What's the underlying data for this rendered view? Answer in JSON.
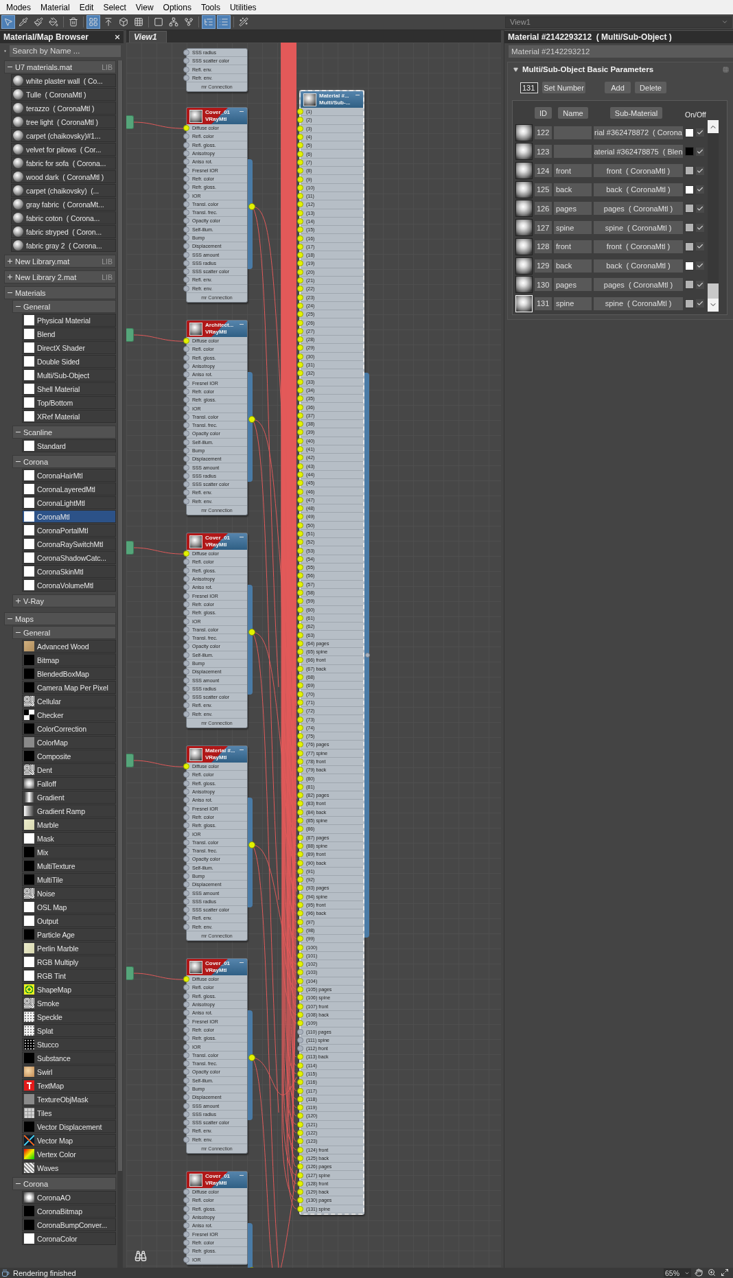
{
  "menu": [
    "Modes",
    "Material",
    "Edit",
    "Select",
    "View",
    "Options",
    "Tools",
    "Utilities"
  ],
  "toolbar_buttons": [
    {
      "active": true
    },
    {
      "active": false
    },
    {
      "active": false
    },
    {
      "active": false
    },
    {
      "active": false
    },
    {
      "active": true
    },
    {
      "active": false
    },
    {
      "active": false
    },
    {
      "active": false
    },
    {
      "active": false
    },
    {
      "active": false
    },
    {
      "active": false
    },
    {
      "active": true
    },
    {
      "active": true
    },
    {
      "active": false
    }
  ],
  "view_selector": "View1",
  "browser": {
    "title": "Material/Map Browser",
    "search": {
      "placeholder": "Search by Name ..."
    },
    "groups": [
      {
        "label": "U7 materials.mat",
        "badge": "LIB",
        "expanded": true,
        "items": [
          {
            "label": "white plaster wall  ( Co...",
            "kind": "sphere",
            "selected": false
          },
          {
            "label": "Tulle  ( CoronaMtl )",
            "kind": "sphere",
            "selected": false
          },
          {
            "label": "terazzo  ( CoronaMtl )",
            "kind": "sphere",
            "selected": false
          },
          {
            "label": "tree light  ( CoronaMtl )",
            "kind": "sphere",
            "selected": false
          },
          {
            "label": "carpet (chaikovsky)#1...",
            "kind": "sphere",
            "selected": false
          },
          {
            "label": "velvet for pilows  ( Cor...",
            "kind": "sphere",
            "selected": false
          },
          {
            "label": "fabric for sofa  ( Corona...",
            "kind": "sphere",
            "selected": false
          },
          {
            "label": "wood dark  ( CoronaMtl )",
            "kind": "sphere",
            "selected": false
          },
          {
            "label": "carpet (chaikovsky)  (...",
            "kind": "sphere",
            "selected": false
          },
          {
            "label": "gray fabric  ( CoronaMt...",
            "kind": "sphere",
            "selected": false
          },
          {
            "label": "fabric coton  ( Corona...",
            "kind": "sphere",
            "selected": false
          },
          {
            "label": "fabric stryped  ( Coron...",
            "kind": "sphere",
            "selected": false
          },
          {
            "label": "fabric gray 2  ( Corona...",
            "kind": "sphere",
            "selected": false
          }
        ]
      },
      {
        "label": "New Library.mat",
        "badge": "LIB",
        "expanded": false
      },
      {
        "label": "New Library 2.mat",
        "badge": "LIB",
        "expanded": false
      },
      {
        "label": "Materials",
        "expanded": true,
        "groups": [
          {
            "label": "General",
            "expanded": true,
            "items": [
              {
                "label": "Physical Material",
                "kind": "white",
                "selected": false
              },
              {
                "label": "Blend",
                "kind": "white",
                "selected": false
              },
              {
                "label": "DirectX Shader",
                "kind": "white",
                "selected": false
              },
              {
                "label": "Double Sided",
                "kind": "white",
                "selected": false
              },
              {
                "label": "Multi/Sub-Object",
                "kind": "white",
                "selected": false
              },
              {
                "label": "Shell Material",
                "kind": "white",
                "selected": false
              },
              {
                "label": "Top/Bottom",
                "kind": "white",
                "selected": false
              },
              {
                "label": "XRef Material",
                "kind": "white",
                "selected": false
              }
            ]
          },
          {
            "label": "Scanline",
            "expanded": true,
            "items": [
              {
                "label": "Standard",
                "kind": "white",
                "selected": false
              }
            ]
          },
          {
            "label": "Corona",
            "expanded": true,
            "items": [
              {
                "label": "CoronaHairMtl",
                "kind": "white",
                "selected": false
              },
              {
                "label": "CoronaLayeredMtl",
                "kind": "white",
                "selected": false
              },
              {
                "label": "CoronaLightMtl",
                "kind": "white",
                "selected": false
              },
              {
                "label": "CoronaMtl",
                "kind": "white",
                "selected": true
              },
              {
                "label": "CoronaPortalMtl",
                "kind": "white",
                "selected": false
              },
              {
                "label": "CoronaRaySwitchMtl",
                "kind": "white",
                "selected": false
              },
              {
                "label": "CoronaShadowCatc...",
                "kind": "white",
                "selected": false
              },
              {
                "label": "CoronaSkinMtl",
                "kind": "white",
                "selected": false
              },
              {
                "label": "CoronaVolumeMtl",
                "kind": "white",
                "selected": false
              }
            ]
          },
          {
            "label": "V-Ray",
            "expanded": false
          }
        ]
      },
      {
        "label": "Maps",
        "expanded": true,
        "groups": [
          {
            "label": "General",
            "expanded": true,
            "items": [
              {
                "label": "Advanced Wood",
                "kind": "wood",
                "selected": false
              },
              {
                "label": "Bitmap",
                "kind": "black",
                "selected": false
              },
              {
                "label": "BlendedBoxMap",
                "kind": "black",
                "selected": false
              },
              {
                "label": "Camera Map Per Pixel",
                "kind": "black",
                "selected": false
              },
              {
                "label": "Cellular",
                "kind": "noise",
                "selected": false
              },
              {
                "label": "Checker",
                "kind": "checker",
                "selected": false
              },
              {
                "label": "ColorCorrection",
                "kind": "black",
                "selected": false
              },
              {
                "label": "ColorMap",
                "kind": "gray",
                "selected": false
              },
              {
                "label": "Composite",
                "kind": "black",
                "selected": false
              },
              {
                "label": "Dent",
                "kind": "noise",
                "selected": false
              },
              {
                "label": "Falloff",
                "kind": "falloff",
                "selected": false
              },
              {
                "label": "Gradient",
                "kind": "gradient",
                "selected": false
              },
              {
                "label": "Gradient Ramp",
                "kind": "ramp",
                "selected": false
              },
              {
                "label": "Marble",
                "kind": "marble",
                "selected": false
              },
              {
                "label": "Mask",
                "kind": "white",
                "selected": false
              },
              {
                "label": "Mix",
                "kind": "black",
                "selected": false
              },
              {
                "label": "MultiTexture",
                "kind": "black",
                "selected": false
              },
              {
                "label": "MultiTile",
                "kind": "black",
                "selected": false
              },
              {
                "label": "Noise",
                "kind": "noise",
                "selected": false
              },
              {
                "label": "OSL Map",
                "kind": "white",
                "selected": false
              },
              {
                "label": "Output",
                "kind": "white",
                "selected": false
              },
              {
                "label": "Particle Age",
                "kind": "black",
                "selected": false
              },
              {
                "label": "Perlin Marble",
                "kind": "marble",
                "selected": false
              },
              {
                "label": "RGB Multiply",
                "kind": "white",
                "selected": false
              },
              {
                "label": "RGB Tint",
                "kind": "white",
                "selected": false
              },
              {
                "label": "ShapeMap",
                "kind": "spiral",
                "selected": false
              },
              {
                "label": "Smoke",
                "kind": "noise",
                "selected": false
              },
              {
                "label": "Speckle",
                "kind": "speckle",
                "selected": false
              },
              {
                "label": "Splat",
                "kind": "speckle",
                "selected": false
              },
              {
                "label": "Stucco",
                "kind": "stucco",
                "selected": false
              },
              {
                "label": "Substance",
                "kind": "black",
                "selected": false
              },
              {
                "label": "Swirl",
                "kind": "swirl",
                "selected": false
              },
              {
                "label": "TextMap",
                "kind": "text",
                "selected": false
              },
              {
                "label": "TextureObjMask",
                "kind": "gray",
                "selected": false
              },
              {
                "label": "Tiles",
                "kind": "tiles",
                "selected": false
              },
              {
                "label": "Vector Displacement",
                "kind": "black",
                "selected": false
              },
              {
                "label": "Vector Map",
                "kind": "vector",
                "selected": false
              },
              {
                "label": "Vertex Color",
                "kind": "rainbow",
                "selected": false
              },
              {
                "label": "Waves",
                "kind": "waves",
                "selected": false
              }
            ]
          },
          {
            "label": "Corona",
            "expanded": true,
            "items": [
              {
                "label": "CoronaAO",
                "kind": "ao",
                "selected": false
              },
              {
                "label": "CoronaBitmap",
                "kind": "black",
                "selected": false
              },
              {
                "label": "CoronaBumpConver...",
                "kind": "black",
                "selected": false
              },
              {
                "label": "CoronaColor",
                "kind": "white",
                "selected": false
              }
            ]
          }
        ]
      }
    ]
  },
  "view": {
    "tab": "View1",
    "nodes": [
      {
        "kind": "vraymtl",
        "selected": false,
        "footer": "mr Connection",
        "slots": [
          {
            "label": "SSS radius",
            "connected": false
          },
          {
            "label": "SSS scatter color",
            "connected": false
          },
          {
            "label": "Refl. env.",
            "connected": false
          },
          {
            "label": "Refr. env.",
            "connected": false
          }
        ]
      },
      {
        "kind": "vraymtl",
        "title": [
          "Cover_01",
          "VRayMtl"
        ],
        "selected": false,
        "footer": "mr Connection",
        "slots": [
          {
            "label": "Diffuse color",
            "connected": true
          },
          {
            "label": "Refl. color",
            "connected": false
          },
          {
            "label": "Refl. gloss.",
            "connected": false
          },
          {
            "label": "Anisotropy",
            "connected": false
          },
          {
            "label": "Aniso rot.",
            "connected": false
          },
          {
            "label": "Fresnel IOR",
            "connected": false
          },
          {
            "label": "Refr. color",
            "connected": false
          },
          {
            "label": "Refr. gloss.",
            "connected": false
          },
          {
            "label": "IOR",
            "connected": false
          },
          {
            "label": "Transl. color",
            "connected": false
          },
          {
            "label": "Transl. frec.",
            "connected": false
          },
          {
            "label": "Opacity color",
            "connected": false
          },
          {
            "label": "Self-illum.",
            "connected": false
          },
          {
            "label": "Bump",
            "connected": false
          },
          {
            "label": "Displacement",
            "connected": false
          },
          {
            "label": "SSS amount",
            "connected": false
          },
          {
            "label": "SSS radius",
            "connected": false
          },
          {
            "label": "SSS scatter color",
            "connected": false
          },
          {
            "label": "Refl. env.",
            "connected": false
          },
          {
            "label": "Refr. env.",
            "connected": false
          }
        ]
      },
      {
        "kind": "vraymtl",
        "title": [
          "Architect...",
          "VRayMtl"
        ],
        "selected": false,
        "footer": "mr Connection",
        "slots": [
          {
            "label": "Diffuse color",
            "connected": true
          },
          {
            "label": "Refl. color",
            "connected": false
          },
          {
            "label": "Refl. gloss.",
            "connected": false
          },
          {
            "label": "Anisotropy",
            "connected": false
          },
          {
            "label": "Aniso rot.",
            "connected": false
          },
          {
            "label": "Fresnel IOR",
            "connected": false
          },
          {
            "label": "Refr. color",
            "connected": false
          },
          {
            "label": "Refr. gloss.",
            "connected": false
          },
          {
            "label": "IOR",
            "connected": false
          },
          {
            "label": "Transl. color",
            "connected": false
          },
          {
            "label": "Transl. frec.",
            "connected": false
          },
          {
            "label": "Opacity color",
            "connected": false
          },
          {
            "label": "Self-illum.",
            "connected": false
          },
          {
            "label": "Bump",
            "connected": false
          },
          {
            "label": "Displacement",
            "connected": false
          },
          {
            "label": "SSS amount",
            "connected": false
          },
          {
            "label": "SSS radius",
            "connected": false
          },
          {
            "label": "SSS scatter color",
            "connected": false
          },
          {
            "label": "Refl. env.",
            "connected": false
          },
          {
            "label": "Refr. env.",
            "connected": false
          }
        ]
      },
      {
        "kind": "vraymtl",
        "title": [
          "Cover_01",
          "VRayMtl"
        ],
        "selected": false,
        "footer": "mr Connection",
        "slots": [
          {
            "label": "Diffuse color",
            "connected": true
          },
          {
            "label": "Refl. color",
            "connected": false
          },
          {
            "label": "Refl. gloss.",
            "connected": false
          },
          {
            "label": "Anisotropy",
            "connected": false
          },
          {
            "label": "Aniso rot.",
            "connected": false
          },
          {
            "label": "Fresnel IOR",
            "connected": false
          },
          {
            "label": "Refr. color",
            "connected": false
          },
          {
            "label": "Refr. gloss.",
            "connected": false
          },
          {
            "label": "IOR",
            "connected": false
          },
          {
            "label": "Transl. color",
            "connected": false
          },
          {
            "label": "Transl. frec.",
            "connected": false
          },
          {
            "label": "Opacity color",
            "connected": false
          },
          {
            "label": "Self-illum.",
            "connected": false
          },
          {
            "label": "Bump",
            "connected": false
          },
          {
            "label": "Displacement",
            "connected": false
          },
          {
            "label": "SSS amount",
            "connected": false
          },
          {
            "label": "SSS radius",
            "connected": false
          },
          {
            "label": "SSS scatter color",
            "connected": false
          },
          {
            "label": "Refl. env.",
            "connected": false
          },
          {
            "label": "Refr. env.",
            "connected": false
          }
        ]
      },
      {
        "kind": "vraymtl",
        "title": [
          "Material #...",
          "VRayMtl"
        ],
        "selected": false,
        "footer": "mr Connection",
        "slots": [
          {
            "label": "Diffuse color",
            "connected": true
          },
          {
            "label": "Refl. color",
            "connected": false
          },
          {
            "label": "Refl. gloss.",
            "connected": false
          },
          {
            "label": "Anisotropy",
            "connected": false
          },
          {
            "label": "Aniso rot.",
            "connected": false
          },
          {
            "label": "Fresnel IOR",
            "connected": false
          },
          {
            "label": "Refr. color",
            "connected": false
          },
          {
            "label": "Refr. gloss.",
            "connected": false
          },
          {
            "label": "IOR",
            "connected": false
          },
          {
            "label": "Transl. color",
            "connected": false
          },
          {
            "label": "Transl. frec.",
            "connected": false
          },
          {
            "label": "Opacity color",
            "connected": false
          },
          {
            "label": "Self-illum.",
            "connected": false
          },
          {
            "label": "Bump",
            "connected": false
          },
          {
            "label": "Displacement",
            "connected": false
          },
          {
            "label": "SSS amount",
            "connected": false
          },
          {
            "label": "SSS radius",
            "connected": false
          },
          {
            "label": "SSS scatter color",
            "connected": false
          },
          {
            "label": "Refl. env.",
            "connected": false
          },
          {
            "label": "Refr. env.",
            "connected": false
          }
        ]
      },
      {
        "kind": "vraymtl",
        "title": [
          "Cover_01",
          "VRayMtl"
        ],
        "selected": false,
        "footer": "mr Connection",
        "slots": [
          {
            "label": "Diffuse color",
            "connected": true
          },
          {
            "label": "Refl. color",
            "connected": false
          },
          {
            "label": "Refl. gloss.",
            "connected": false
          },
          {
            "label": "Anisotropy",
            "connected": false
          },
          {
            "label": "Aniso rot.",
            "connected": false
          },
          {
            "label": "Fresnel IOR",
            "connected": false
          },
          {
            "label": "Refr. color",
            "connected": false
          },
          {
            "label": "Refr. gloss.",
            "connected": false
          },
          {
            "label": "IOR",
            "connected": false
          },
          {
            "label": "Transl. color",
            "connected": false
          },
          {
            "label": "Transl. frec.",
            "connected": false
          },
          {
            "label": "Opacity color",
            "connected": false
          },
          {
            "label": "Self-illum.",
            "connected": false
          },
          {
            "label": "Bump",
            "connected": false
          },
          {
            "label": "Displacement",
            "connected": false
          },
          {
            "label": "SSS amount",
            "connected": false
          },
          {
            "label": "SSS radius",
            "connected": false
          },
          {
            "label": "SSS scatter color",
            "connected": false
          },
          {
            "label": "Refl. env.",
            "connected": false
          },
          {
            "label": "Refr. env.",
            "connected": false
          }
        ]
      },
      {
        "kind": "vraymtl",
        "title": [
          "Cover_01",
          "VRayMtl"
        ],
        "selected": false,
        "slots": [
          {
            "label": "Diffuse color",
            "connected": false
          },
          {
            "label": "Refl. color",
            "connected": false
          },
          {
            "label": "Refl. gloss.",
            "connected": false
          },
          {
            "label": "Anisotropy",
            "connected": false
          },
          {
            "label": "Aniso rot.",
            "connected": false
          },
          {
            "label": "Fresnel IOR",
            "connected": false
          },
          {
            "label": "Refr. color",
            "connected": false
          },
          {
            "label": "Refr. gloss.",
            "connected": false
          },
          {
            "label": "IOR",
            "connected": false
          }
        ]
      },
      {
        "kind": "multi",
        "title": [
          "Material #...",
          "Multi/Sub-..."
        ],
        "selected": true,
        "slots": [
          {
            "label": "(1)",
            "connected": true
          },
          {
            "label": "(2)",
            "connected": true
          },
          {
            "label": "(3)",
            "connected": true
          },
          {
            "label": "(4)",
            "connected": true
          },
          {
            "label": "(5)",
            "connected": true
          },
          {
            "label": "(6)",
            "connected": true
          },
          {
            "label": "(7)",
            "connected": true
          },
          {
            "label": "(8)",
            "connected": true
          },
          {
            "label": "(9)",
            "connected": true
          },
          {
            "label": "(10)",
            "connected": true
          },
          {
            "label": "(11)",
            "connected": true
          },
          {
            "label": "(12)",
            "connected": true
          },
          {
            "label": "(13)",
            "connected": true
          },
          {
            "label": "(14)",
            "connected": true
          },
          {
            "label": "(15)",
            "connected": true
          },
          {
            "label": "(16)",
            "connected": true
          },
          {
            "label": "(17)",
            "connected": true
          },
          {
            "label": "(18)",
            "connected": true
          },
          {
            "label": "(19)",
            "connected": true
          },
          {
            "label": "(20)",
            "connected": true
          },
          {
            "label": "(21)",
            "connected": true
          },
          {
            "label": "(22)",
            "connected": true
          },
          {
            "label": "(23)",
            "connected": true
          },
          {
            "label": "(24)",
            "connected": true
          },
          {
            "label": "(25)",
            "connected": true
          },
          {
            "label": "(26)",
            "connected": true
          },
          {
            "label": "(27)",
            "connected": true
          },
          {
            "label": "(28)",
            "connected": true
          },
          {
            "label": "(29)",
            "connected": true
          },
          {
            "label": "(30)",
            "connected": true
          },
          {
            "label": "(31)",
            "connected": true
          },
          {
            "label": "(32)",
            "connected": true
          },
          {
            "label": "(33)",
            "connected": true
          },
          {
            "label": "(34)",
            "connected": true
          },
          {
            "label": "(35)",
            "connected": true
          },
          {
            "label": "(36)",
            "connected": true
          },
          {
            "label": "(37)",
            "connected": true
          },
          {
            "label": "(38)",
            "connected": true
          },
          {
            "label": "(39)",
            "connected": true
          },
          {
            "label": "(40)",
            "connected": true
          },
          {
            "label": "(41)",
            "connected": true
          },
          {
            "label": "(42)",
            "connected": true
          },
          {
            "label": "(43)",
            "connected": true
          },
          {
            "label": "(44)",
            "connected": true
          },
          {
            "label": "(45)",
            "connected": true
          },
          {
            "label": "(46)",
            "connected": true
          },
          {
            "label": "(47)",
            "connected": true
          },
          {
            "label": "(48)",
            "connected": true
          },
          {
            "label": "(49)",
            "connected": true
          },
          {
            "label": "(50)",
            "connected": true
          },
          {
            "label": "(51)",
            "connected": true
          },
          {
            "label": "(52)",
            "connected": true
          },
          {
            "label": "(53)",
            "connected": true
          },
          {
            "label": "(54)",
            "connected": true
          },
          {
            "label": "(55)",
            "connected": true
          },
          {
            "label": "(56)",
            "connected": true
          },
          {
            "label": "(57)",
            "connected": true
          },
          {
            "label": "(58)",
            "connected": true
          },
          {
            "label": "(59)",
            "connected": true
          },
          {
            "label": "(60)",
            "connected": true
          },
          {
            "label": "(61)",
            "connected": true
          },
          {
            "label": "(62)",
            "connected": true
          },
          {
            "label": "(63)",
            "connected": true
          },
          {
            "label": "(64) pages",
            "connected": true
          },
          {
            "label": "(65) spine",
            "connected": true
          },
          {
            "label": "(66) front",
            "connected": true
          },
          {
            "label": "(67) back",
            "connected": true
          },
          {
            "label": "(68)",
            "connected": true
          },
          {
            "label": "(69)",
            "connected": true
          },
          {
            "label": "(70)",
            "connected": true
          },
          {
            "label": "(71)",
            "connected": true
          },
          {
            "label": "(72)",
            "connected": true
          },
          {
            "label": "(73)",
            "connected": true
          },
          {
            "label": "(74)",
            "connected": true
          },
          {
            "label": "(75)",
            "connected": true
          },
          {
            "label": "(76) pages",
            "connected": true
          },
          {
            "label": "(77) spine",
            "connected": true
          },
          {
            "label": "(78) front",
            "connected": true
          },
          {
            "label": "(79) back",
            "connected": true
          },
          {
            "label": "(80)",
            "connected": true
          },
          {
            "label": "(81)",
            "connected": true
          },
          {
            "label": "(82) pages",
            "connected": true
          },
          {
            "label": "(83) front",
            "connected": true
          },
          {
            "label": "(84) back",
            "connected": true
          },
          {
            "label": "(85) spine",
            "connected": true
          },
          {
            "label": "(86)",
            "connected": true
          },
          {
            "label": "(87) pages",
            "connected": true
          },
          {
            "label": "(88) spine",
            "connected": true
          },
          {
            "label": "(89) front",
            "connected": true
          },
          {
            "label": "(90) back",
            "connected": true
          },
          {
            "label": "(91)",
            "connected": true
          },
          {
            "label": "(92)",
            "connected": true
          },
          {
            "label": "(93) pages",
            "connected": true
          },
          {
            "label": "(94) spine",
            "connected": true
          },
          {
            "label": "(95) front",
            "connected": true
          },
          {
            "label": "(96) back",
            "connected": true
          },
          {
            "label": "(97)",
            "connected": true
          },
          {
            "label": "(98)",
            "connected": true
          },
          {
            "label": "(99)",
            "connected": true
          },
          {
            "label": "(100)",
            "connected": true
          },
          {
            "label": "(101)",
            "connected": true
          },
          {
            "label": "(102)",
            "connected": true
          },
          {
            "label": "(103)",
            "connected": true
          },
          {
            "label": "(104)",
            "connected": true
          },
          {
            "label": "(105) pages",
            "connected": true
          },
          {
            "label": "(106) spine",
            "connected": true
          },
          {
            "label": "(107) front",
            "connected": true
          },
          {
            "label": "(108) back",
            "connected": true
          },
          {
            "label": "(109)",
            "connected": true
          },
          {
            "label": "(110) pages",
            "connected": false
          },
          {
            "label": "(111) spine",
            "connected": false
          },
          {
            "label": "(112) front",
            "connected": false
          },
          {
            "label": "(113) back",
            "connected": true
          },
          {
            "label": "(114)",
            "connected": true
          },
          {
            "label": "(115)",
            "connected": true
          },
          {
            "label": "(116)",
            "connected": true
          },
          {
            "label": "(117)",
            "connected": true
          },
          {
            "label": "(118)",
            "connected": true
          },
          {
            "label": "(119)",
            "connected": true
          },
          {
            "label": "(120)",
            "connected": true
          },
          {
            "label": "(121)",
            "connected": true
          },
          {
            "label": "(122)",
            "connected": true
          },
          {
            "label": "(123)",
            "connected": true
          },
          {
            "label": "(124) front",
            "connected": true
          },
          {
            "label": "(125) back",
            "connected": true
          },
          {
            "label": "(126) pages",
            "connected": true
          },
          {
            "label": "(127) spine",
            "connected": true
          },
          {
            "label": "(128) front",
            "connected": true
          },
          {
            "label": "(129) back",
            "connected": true
          },
          {
            "label": "(130) pages",
            "connected": true
          },
          {
            "label": "(131) spine",
            "connected": true
          }
        ]
      }
    ]
  },
  "editor": {
    "title": "Material #2142293212  ( Multi/Sub-Object )",
    "name_field": "Material #2142293212",
    "rollout": {
      "title": "Multi/Sub-Object Basic Parameters",
      "expanded": true,
      "count_field": "131",
      "buttons": [
        "Set Number",
        "Add",
        "Delete"
      ],
      "columns": [
        "ID",
        "Name",
        "Sub-Material",
        "On/Off"
      ],
      "rows": [
        {
          "id": "122",
          "material": "rial #362478872  ( Corona",
          "color": "#ffffff",
          "on": true,
          "selected": false
        },
        {
          "id": "123",
          "material": "aterial #362478875  ( Blen",
          "color": "#000000",
          "on": true,
          "selected": false
        },
        {
          "id": "124",
          "name": "front",
          "material": "front  ( CoronaMtl )",
          "color": "#b4b4b4",
          "on": true,
          "selected": false
        },
        {
          "id": "125",
          "name": "back",
          "material": "back  ( CoronaMtl )",
          "color": "#ffffff",
          "on": true,
          "selected": false
        },
        {
          "id": "126",
          "name": "pages",
          "material": "pages  ( CoronaMtl )",
          "color": "#b4b4b4",
          "on": true,
          "selected": false
        },
        {
          "id": "127",
          "name": "spine",
          "material": "spine  ( CoronaMtl )",
          "color": "#b4b4b4",
          "on": true,
          "selected": false
        },
        {
          "id": "128",
          "name": "front",
          "material": "front  ( CoronaMtl )",
          "color": "#b4b4b4",
          "on": true,
          "selected": false
        },
        {
          "id": "129",
          "name": "back",
          "material": "back  ( CoronaMtl )",
          "color": "#ffffff",
          "on": true,
          "selected": false
        },
        {
          "id": "130",
          "name": "pages",
          "material": "pages  ( CoronaMtl )",
          "color": "#b4b4b4",
          "on": true,
          "selected": false
        },
        {
          "id": "131",
          "name": "spine",
          "material": "spine  ( CoronaMtl )",
          "color": "#b4b4b4",
          "on": true,
          "selected": true
        }
      ]
    }
  },
  "status": {
    "message": "Rendering finished",
    "zoom": "65%"
  }
}
